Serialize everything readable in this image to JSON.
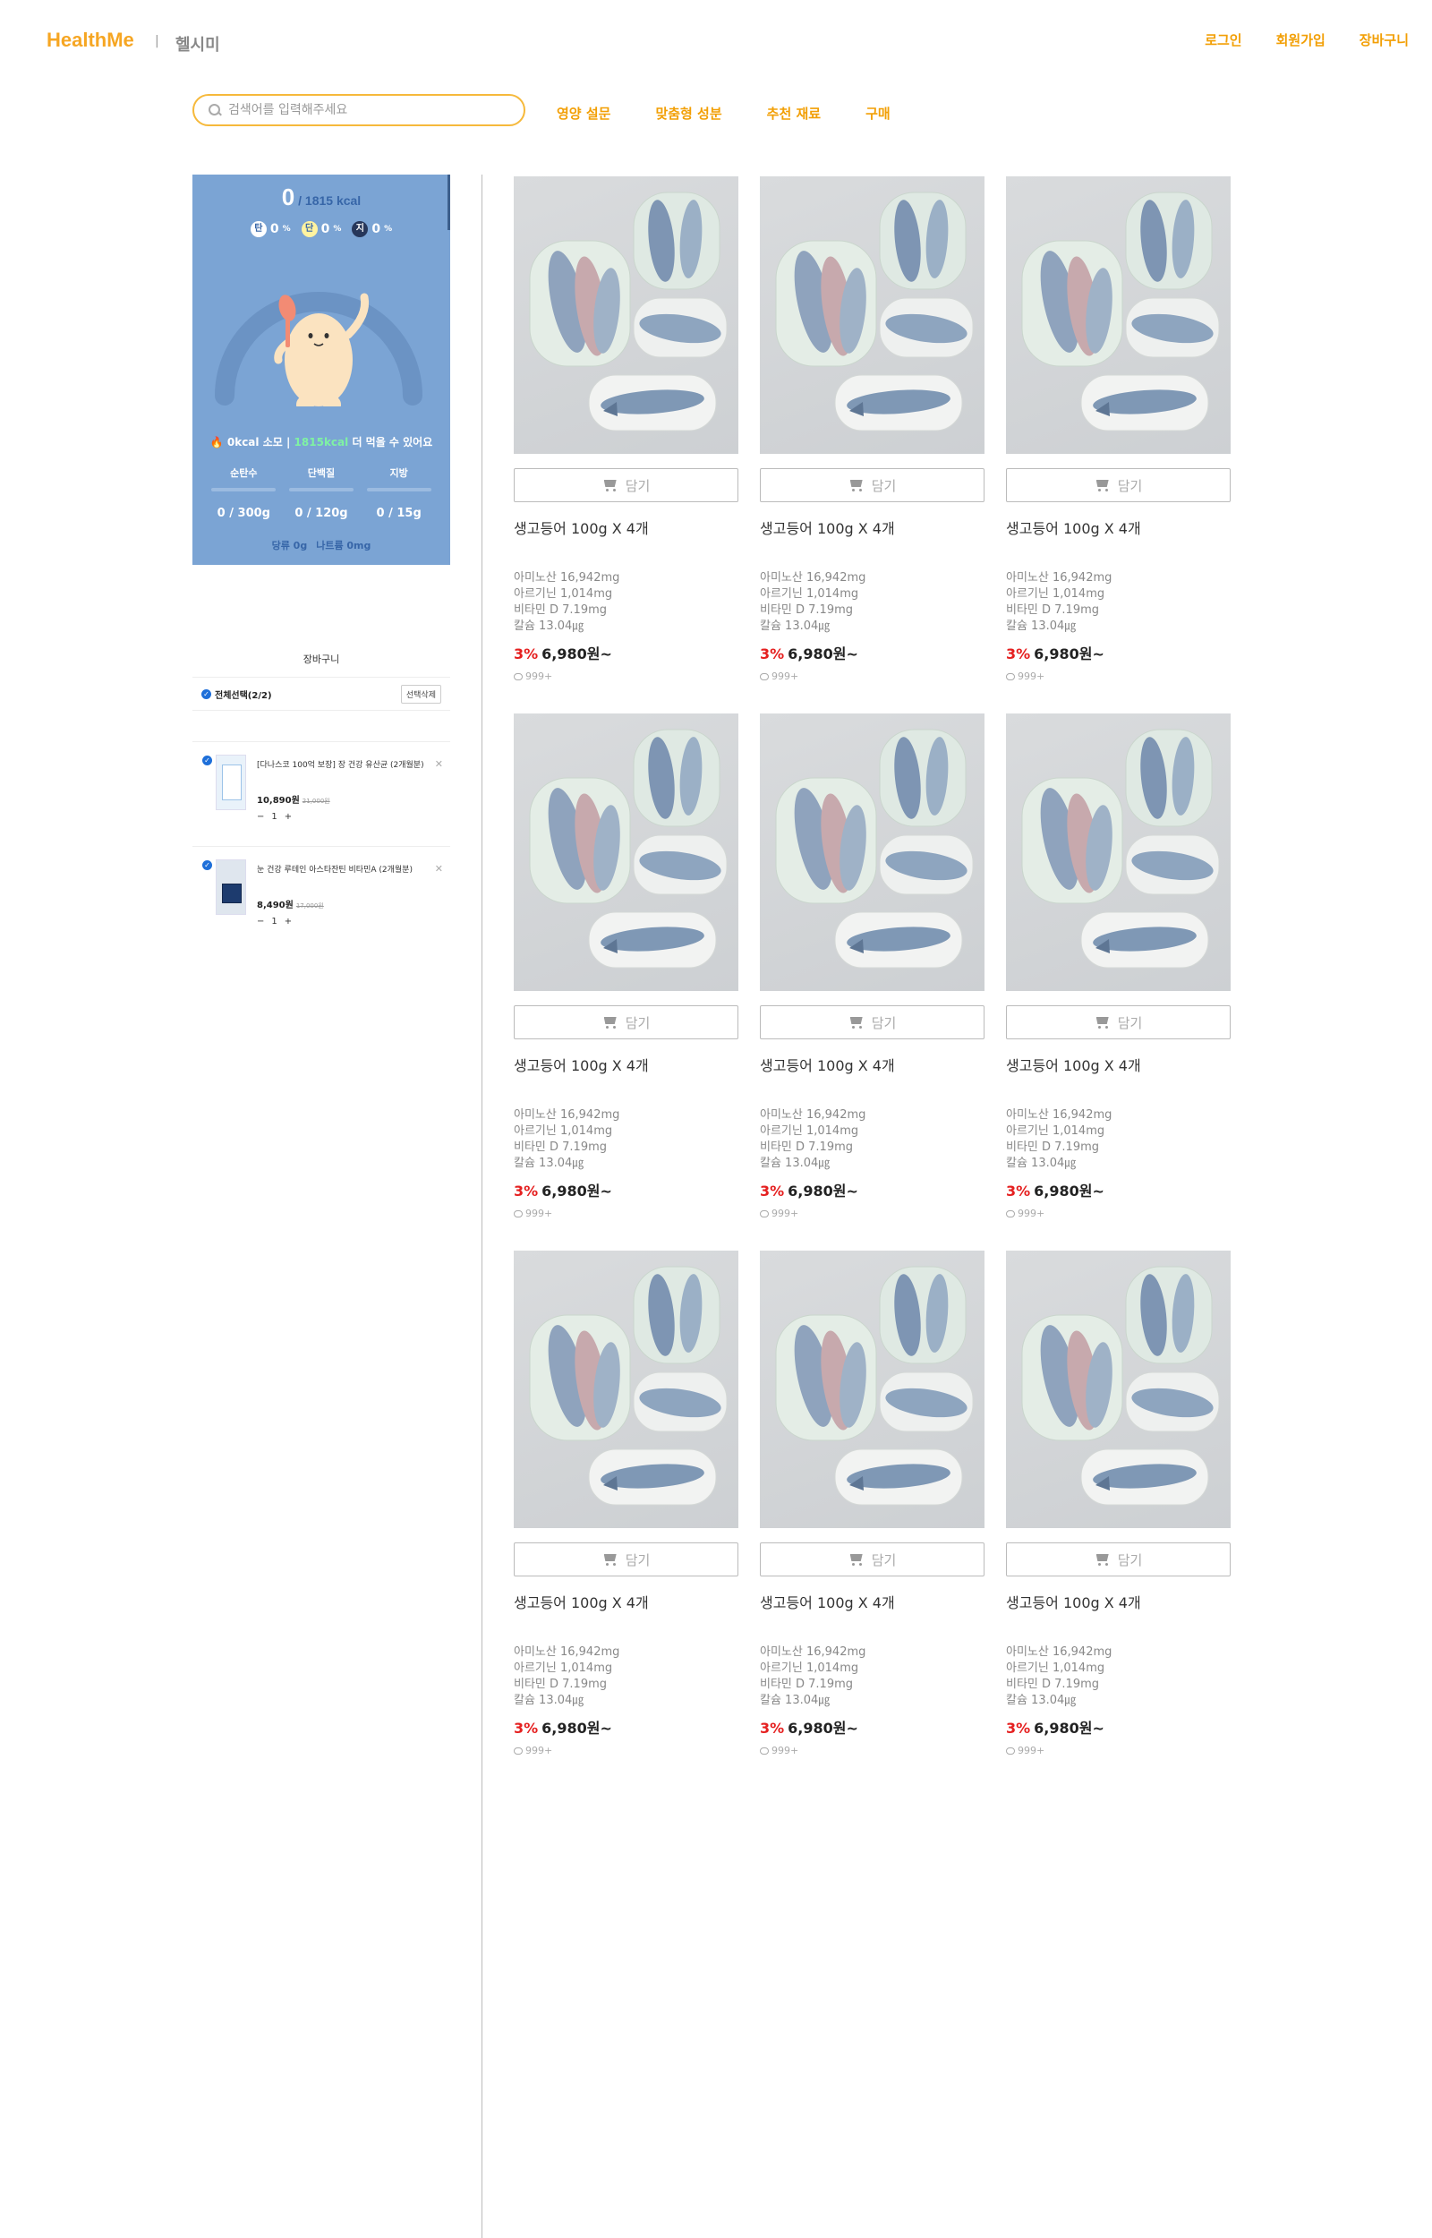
{
  "header": {
    "logo": "HealthMe",
    "separator": "|",
    "logo_ko": "헬시미",
    "links": [
      "로그인",
      "회원가입",
      "장바구니"
    ]
  },
  "search": {
    "placeholder": "검색어를 입력해주세요"
  },
  "nav": [
    "영양 설문",
    "맞춤형 성분",
    "추천 재료",
    "구매"
  ],
  "nutrition": {
    "kcal_current": "0",
    "kcal_total": " / 1815 kcal",
    "ratios": [
      {
        "badge": "탄",
        "value": "0",
        "unit": "%"
      },
      {
        "badge": "단",
        "value": "0",
        "unit": "%"
      },
      {
        "badge": "지",
        "value": "0",
        "unit": "%"
      }
    ],
    "burn_prefix": "0kcal 소모",
    "burn_sep": "|",
    "burn_remaining": "1815kcal",
    "burn_suffix": "더 먹을 수 있어요",
    "macros": [
      {
        "label": "순탄수",
        "value": "0 / 300g"
      },
      {
        "label": "단백질",
        "value": "0 / 120g"
      },
      {
        "label": "지방",
        "value": "0 / 15g"
      }
    ],
    "sugar": "당류 0g",
    "sodium": "나트륨 0mg"
  },
  "cart": {
    "title": "장바구니",
    "select_all": "전체선택(2/2)",
    "delete_selected": "선택삭제",
    "items": [
      {
        "name": "[다나스코 100억 보장] 장 건강 유산균 (2개월분)",
        "price": "10,890원",
        "old_price": "21,000원",
        "qty": "1"
      },
      {
        "name": "눈 건강 루테인 아스타잔틴 비타민A (2개월분)",
        "price": "8,490원",
        "old_price": "17,000원",
        "qty": "1"
      }
    ]
  },
  "product_defaults": {
    "cart_button": "담기",
    "title": "생고등어 100g X 4개",
    "nutrients": [
      "아미노산 16,942mg",
      "아르기닌 1,014mg",
      "비타민 D 7.19mg",
      "칼슘 13.04㎍"
    ],
    "discount": "3%",
    "price": "6,980원~",
    "reviews": "999+"
  },
  "products": [
    {
      "title": "생고등어 100g X 4개"
    },
    {
      "title": "생고등어 100g X 4개"
    },
    {
      "title": "생고등어 100g X 4개"
    },
    {
      "title": "생고등어 100g X 4개"
    },
    {
      "title": "생고등어 100g X 4개"
    },
    {
      "title": "생고등어 100g X 4개"
    },
    {
      "title": "생고등어 100g X 4개"
    },
    {
      "title": "생고등어 100g X 4개"
    },
    {
      "title": "생고등어 100g X 4개"
    }
  ],
  "colors": {
    "brand": "#f6a623",
    "panel": "#7ba4d4",
    "discount": "#e52020"
  }
}
